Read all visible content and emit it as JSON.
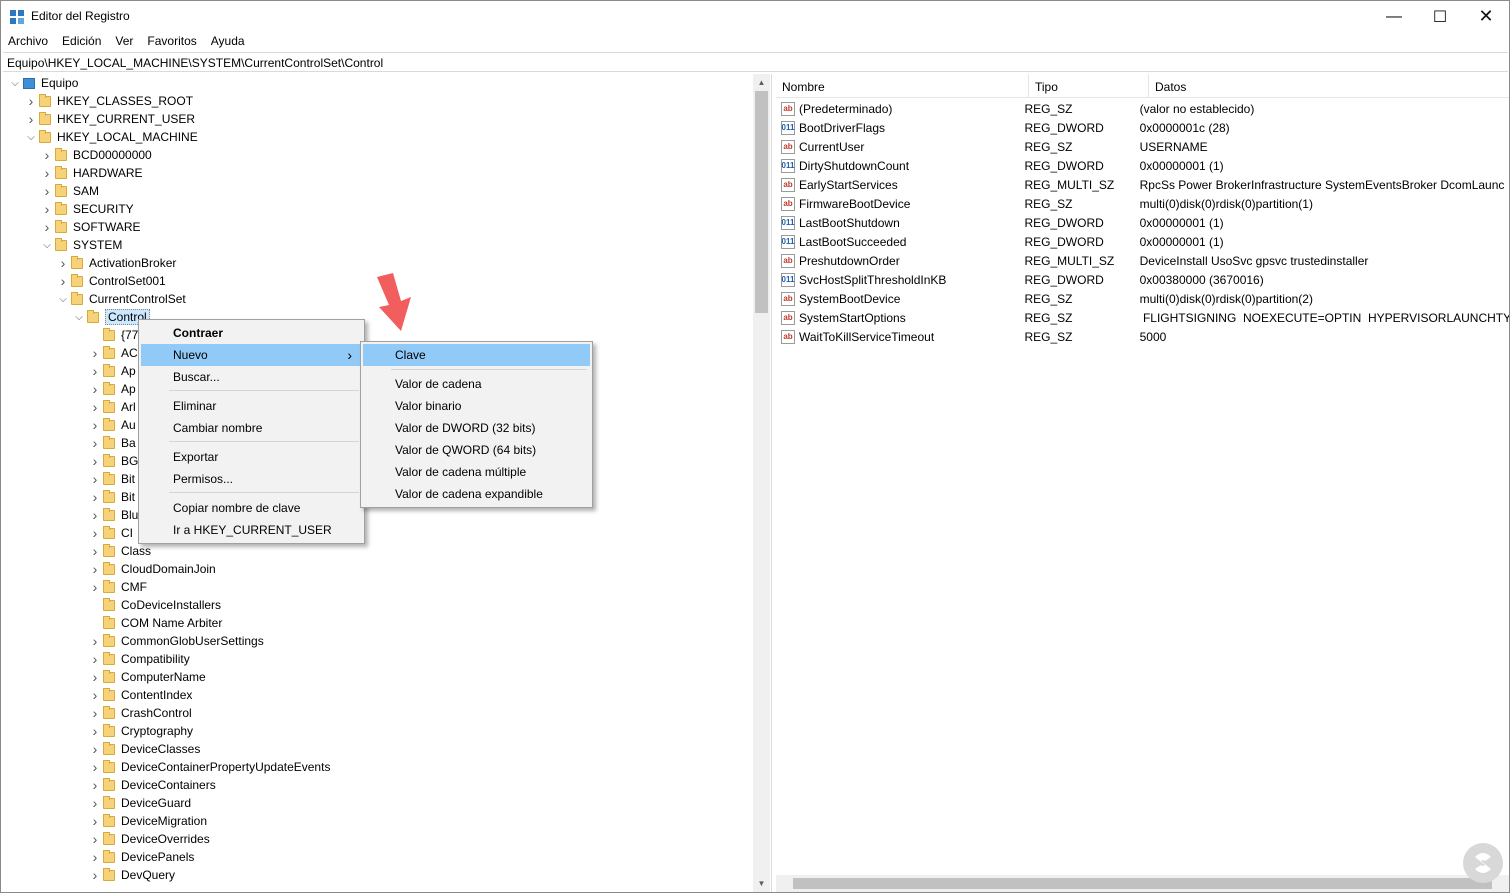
{
  "window": {
    "title": "Editor del Registro",
    "controls": {
      "minimize": "—",
      "maximize": "☐",
      "close": "✕"
    }
  },
  "menubar": [
    "Archivo",
    "Edición",
    "Ver",
    "Favoritos",
    "Ayuda"
  ],
  "address": "Equipo\\HKEY_LOCAL_MACHINE\\SYSTEM\\CurrentControlSet\\Control",
  "tree": {
    "root": "Equipo",
    "items": [
      {
        "label": "HKEY_CLASSES_ROOT",
        "depth": 1,
        "expanded": false
      },
      {
        "label": "HKEY_CURRENT_USER",
        "depth": 1,
        "expanded": false
      },
      {
        "label": "HKEY_LOCAL_MACHINE",
        "depth": 1,
        "expanded": true
      },
      {
        "label": "BCD00000000",
        "depth": 2,
        "expanded": false
      },
      {
        "label": "HARDWARE",
        "depth": 2,
        "expanded": false
      },
      {
        "label": "SAM",
        "depth": 2,
        "expanded": false
      },
      {
        "label": "SECURITY",
        "depth": 2,
        "expanded": false
      },
      {
        "label": "SOFTWARE",
        "depth": 2,
        "expanded": false
      },
      {
        "label": "SYSTEM",
        "depth": 2,
        "expanded": true
      },
      {
        "label": "ActivationBroker",
        "depth": 3,
        "expanded": false
      },
      {
        "label": "ControlSet001",
        "depth": 3,
        "expanded": false
      },
      {
        "label": "CurrentControlSet",
        "depth": 3,
        "expanded": true
      },
      {
        "label": "Control",
        "depth": 4,
        "expanded": true,
        "selected": true
      },
      {
        "label": "{77",
        "depth": 5,
        "expanded": null
      },
      {
        "label": "AC",
        "depth": 5,
        "expanded": false
      },
      {
        "label": "Ap",
        "depth": 5,
        "expanded": false
      },
      {
        "label": "Ap",
        "depth": 5,
        "expanded": false
      },
      {
        "label": "Arl",
        "depth": 5,
        "expanded": false
      },
      {
        "label": "Au",
        "depth": 5,
        "expanded": false
      },
      {
        "label": "Ba",
        "depth": 5,
        "expanded": false
      },
      {
        "label": "BG",
        "depth": 5,
        "expanded": false
      },
      {
        "label": "Bit",
        "depth": 5,
        "expanded": false
      },
      {
        "label": "Bit",
        "depth": 5,
        "expanded": false
      },
      {
        "label": "Blu",
        "depth": 5,
        "expanded": false
      },
      {
        "label": "CI",
        "depth": 5,
        "expanded": false
      },
      {
        "label": "Class",
        "depth": 5,
        "expanded": false
      },
      {
        "label": "CloudDomainJoin",
        "depth": 5,
        "expanded": false
      },
      {
        "label": "CMF",
        "depth": 5,
        "expanded": false
      },
      {
        "label": "CoDeviceInstallers",
        "depth": 5,
        "expanded": null
      },
      {
        "label": "COM Name Arbiter",
        "depth": 5,
        "expanded": null
      },
      {
        "label": "CommonGlobUserSettings",
        "depth": 5,
        "expanded": false
      },
      {
        "label": "Compatibility",
        "depth": 5,
        "expanded": false
      },
      {
        "label": "ComputerName",
        "depth": 5,
        "expanded": false
      },
      {
        "label": "ContentIndex",
        "depth": 5,
        "expanded": false
      },
      {
        "label": "CrashControl",
        "depth": 5,
        "expanded": false
      },
      {
        "label": "Cryptography",
        "depth": 5,
        "expanded": false
      },
      {
        "label": "DeviceClasses",
        "depth": 5,
        "expanded": false
      },
      {
        "label": "DeviceContainerPropertyUpdateEvents",
        "depth": 5,
        "expanded": false
      },
      {
        "label": "DeviceContainers",
        "depth": 5,
        "expanded": false
      },
      {
        "label": "DeviceGuard",
        "depth": 5,
        "expanded": false
      },
      {
        "label": "DeviceMigration",
        "depth": 5,
        "expanded": false
      },
      {
        "label": "DeviceOverrides",
        "depth": 5,
        "expanded": false
      },
      {
        "label": "DevicePanels",
        "depth": 5,
        "expanded": false
      },
      {
        "label": "DevQuery",
        "depth": 5,
        "expanded": false
      }
    ]
  },
  "list": {
    "columns": [
      "Nombre",
      "Tipo",
      "Datos"
    ],
    "rows": [
      {
        "icon": "string-value-icon",
        "name": "(Predeterminado)",
        "type": "REG_SZ",
        "data": "(valor no establecido)"
      },
      {
        "icon": "binary-value-icon",
        "name": "BootDriverFlags",
        "type": "REG_DWORD",
        "data": "0x0000001c (28)"
      },
      {
        "icon": "string-value-icon",
        "name": "CurrentUser",
        "type": "REG_SZ",
        "data": "USERNAME"
      },
      {
        "icon": "binary-value-icon",
        "name": "DirtyShutdownCount",
        "type": "REG_DWORD",
        "data": "0x00000001 (1)"
      },
      {
        "icon": "string-value-icon",
        "name": "EarlyStartServices",
        "type": "REG_MULTI_SZ",
        "data": "RpcSs Power BrokerInfrastructure SystemEventsBroker DcomLaunc"
      },
      {
        "icon": "string-value-icon",
        "name": "FirmwareBootDevice",
        "type": "REG_SZ",
        "data": "multi(0)disk(0)rdisk(0)partition(1)"
      },
      {
        "icon": "binary-value-icon",
        "name": "LastBootShutdown",
        "type": "REG_DWORD",
        "data": "0x00000001 (1)"
      },
      {
        "icon": "binary-value-icon",
        "name": "LastBootSucceeded",
        "type": "REG_DWORD",
        "data": "0x00000001 (1)"
      },
      {
        "icon": "string-value-icon",
        "name": "PreshutdownOrder",
        "type": "REG_MULTI_SZ",
        "data": "DeviceInstall UsoSvc gpsvc trustedinstaller"
      },
      {
        "icon": "binary-value-icon",
        "name": "SvcHostSplitThresholdInKB",
        "type": "REG_DWORD",
        "data": "0x00380000 (3670016)"
      },
      {
        "icon": "string-value-icon",
        "name": "SystemBootDevice",
        "type": "REG_SZ",
        "data": "multi(0)disk(0)rdisk(0)partition(2)"
      },
      {
        "icon": "string-value-icon",
        "name": "SystemStartOptions",
        "type": "REG_SZ",
        "data": " FLIGHTSIGNING  NOEXECUTE=OPTIN  HYPERVISORLAUNCHTYPE"
      },
      {
        "icon": "string-value-icon",
        "name": "WaitToKillServiceTimeout",
        "type": "REG_SZ",
        "data": "5000"
      }
    ]
  },
  "context_menu": {
    "items": [
      "Contraer",
      "Nuevo",
      "Buscar...",
      "Eliminar",
      "Cambiar nombre",
      "Exportar",
      "Permisos...",
      "Copiar nombre de clave",
      "Ir a HKEY_CURRENT_USER"
    ]
  },
  "submenu": {
    "items": [
      "Clave",
      "Valor de cadena",
      "Valor binario",
      "Valor de DWORD (32 bits)",
      "Valor de QWORD (64 bits)",
      "Valor de cadena múltiple",
      "Valor de cadena expandible"
    ]
  },
  "colors": {
    "highlight": "#91c9f7",
    "selection": "#cce8ff",
    "annotation_arrow": "#f25d5d",
    "watermark": "#d8d8d8"
  }
}
